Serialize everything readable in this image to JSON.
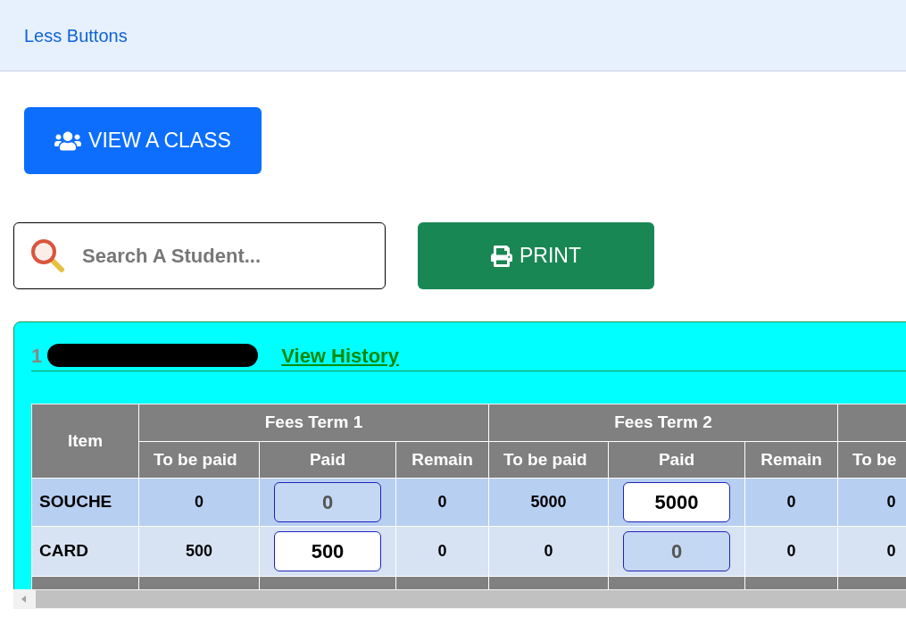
{
  "top_bar": {
    "label": "Less Buttons"
  },
  "view_class_button": {
    "label": "VIEW A CLASS"
  },
  "search": {
    "placeholder": "Search A Student..."
  },
  "print_button": {
    "label": "PRINT"
  },
  "student_panel": {
    "title": "1",
    "history_link": "View History",
    "table": {
      "item_header": "Item",
      "groups": [
        {
          "label": "Fees Term 1"
        },
        {
          "label": "Fees Term 2"
        }
      ],
      "subheaders": [
        "To be paid",
        "Paid",
        "Remain",
        "To be paid",
        "Paid",
        "Remain",
        "To be"
      ],
      "rows": [
        {
          "item": "SOUCHE",
          "cells": [
            {
              "kind": "text",
              "value": "0"
            },
            {
              "kind": "input",
              "value": "0",
              "disabled": true
            },
            {
              "kind": "text",
              "value": "0"
            },
            {
              "kind": "text",
              "value": "5000"
            },
            {
              "kind": "input",
              "value": "5000",
              "disabled": false
            },
            {
              "kind": "text",
              "value": "0"
            },
            {
              "kind": "text",
              "value": "0"
            }
          ]
        },
        {
          "item": "CARD",
          "cells": [
            {
              "kind": "text",
              "value": "500"
            },
            {
              "kind": "input",
              "value": "500",
              "disabled": false
            },
            {
              "kind": "text",
              "value": "0"
            },
            {
              "kind": "text",
              "value": "0"
            },
            {
              "kind": "input",
              "value": "0",
              "disabled": true
            },
            {
              "kind": "text",
              "value": "0"
            },
            {
              "kind": "text",
              "value": "0"
            }
          ]
        }
      ]
    }
  }
}
